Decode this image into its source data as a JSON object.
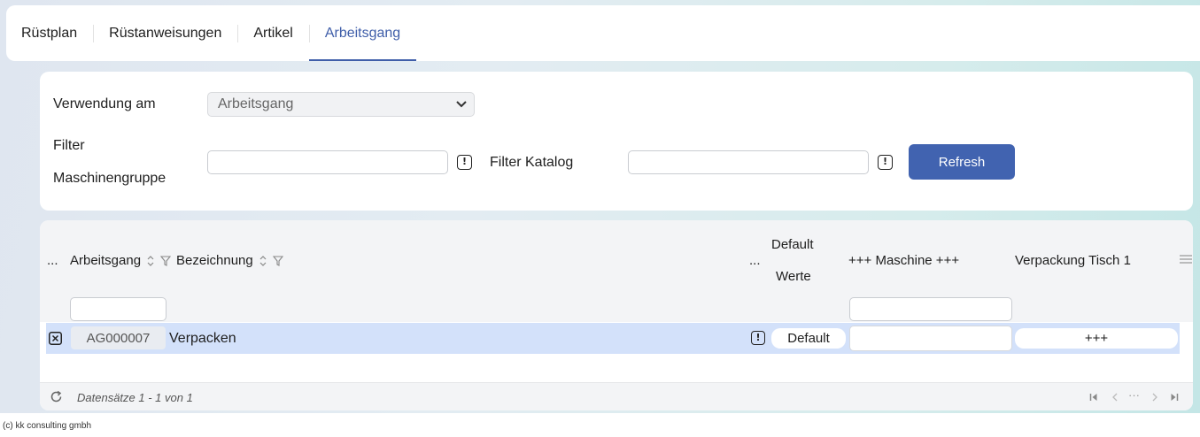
{
  "tabs": [
    {
      "label": "Rüstplan",
      "active": false
    },
    {
      "label": "Rüstanweisungen",
      "active": false
    },
    {
      "label": "Artikel",
      "active": false
    },
    {
      "label": "Arbeitsgang",
      "active": true
    }
  ],
  "filters": {
    "verwendung_label": "Verwendung am",
    "verwendung_value": "Arbeitsgang",
    "maschinengruppe_label_line1": "Filter",
    "maschinengruppe_label_line2": "Maschinengruppe",
    "maschinengruppe_value": "",
    "katalog_label": "Filter Katalog",
    "katalog_value": "",
    "warn_symbol": "!",
    "refresh_label": "Refresh"
  },
  "grid": {
    "columns": {
      "menu": "...",
      "arbeitsgang": "Arbeitsgang",
      "bezeichnung": "Bezeichnung",
      "dots": "...",
      "default_line1": "Default",
      "default_line2": "Werte",
      "maschine": "+++ Maschine +++",
      "verpackung": "Verpackung Tisch 1"
    },
    "column_filters": {
      "arbeitsgang": "",
      "maschine": ""
    },
    "rows": [
      {
        "arbeitsgang": "AG000007",
        "bezeichnung": "Verpacken",
        "warn": "!",
        "default_button": "Default",
        "maschine": "",
        "verpackung_button": "+++"
      }
    ],
    "footer": "Datensätze 1 - 1 von 1",
    "pager": {
      "ellipsis": "···"
    }
  },
  "copyright": "(c) kk consulting gmbh",
  "colors": {
    "accent": "#4163b0",
    "row_selected": "#d3e1fa"
  }
}
